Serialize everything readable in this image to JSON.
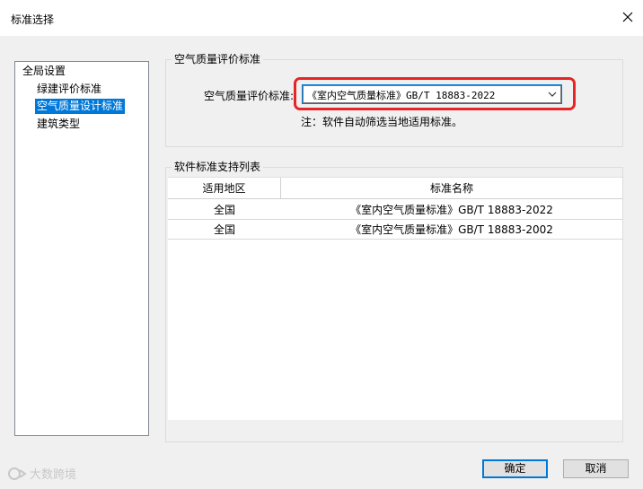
{
  "window": {
    "title": "标准选择",
    "close_icon": "close-icon"
  },
  "tree": {
    "items": [
      {
        "label": "全局设置",
        "level": 0,
        "selected": false
      },
      {
        "label": "绿建评价标准",
        "level": 1,
        "selected": false
      },
      {
        "label": "空气质量设计标准",
        "level": 1,
        "selected": true
      },
      {
        "label": "建筑类型",
        "level": 1,
        "selected": false
      }
    ]
  },
  "standard_group": {
    "title": "空气质量评价标准",
    "field_label": "空气质量评价标准:",
    "selected_value": "《室内空气质量标准》GB/T 18883-2022",
    "dropdown_icon": "chevron-down-icon",
    "highlight_color": "#e62626",
    "note": "注：软件自动筛选当地适用标准。"
  },
  "support_group": {
    "title": "软件标准支持列表",
    "columns": [
      "适用地区",
      "标准名称"
    ],
    "rows": [
      [
        "全国",
        "《室内空气质量标准》GB/T 18883-2022"
      ],
      [
        "全国",
        "《室内空气质量标准》GB/T 18883-2002"
      ]
    ]
  },
  "buttons": {
    "ok": "确定",
    "cancel": "取消"
  },
  "watermark": {
    "text": "大数跨境",
    "icon": "logo-icon"
  },
  "colors": {
    "accent": "#0078d7",
    "highlight": "#e62626"
  }
}
